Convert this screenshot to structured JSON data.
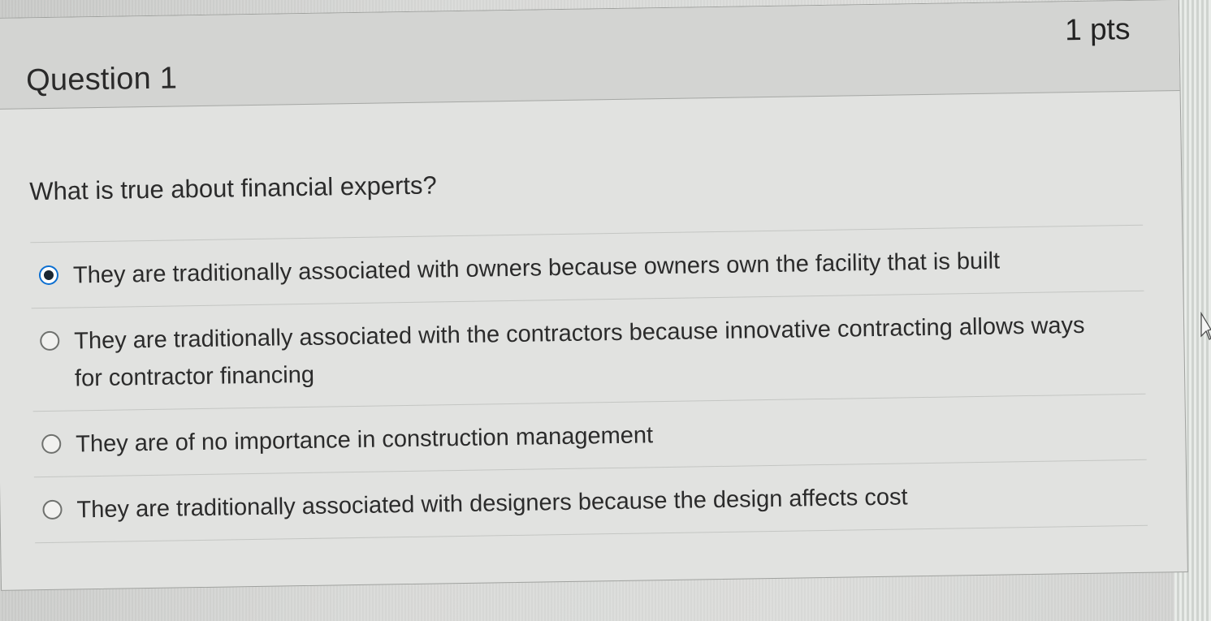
{
  "question": {
    "title": "Question 1",
    "points": "1 pts",
    "text": "What is true about financial experts?"
  },
  "answers": [
    {
      "label": "They are traditionally associated with owners because owners own the facility that is built",
      "selected": true
    },
    {
      "label": "They are traditionally associated with the contractors because innovative contracting allows ways for contractor financing",
      "selected": false
    },
    {
      "label": "They are of no importance in construction management",
      "selected": false
    },
    {
      "label": "They are traditionally associated with designers because the design affects cost",
      "selected": false
    }
  ],
  "colors": {
    "radio_selected": "#0c6fd1",
    "text": "#2b2b2b",
    "header_bg": "#d3d4d2"
  },
  "icons": [
    "radio-selected-icon",
    "radio-unselected-icon",
    "mouse-cursor-icon"
  ]
}
